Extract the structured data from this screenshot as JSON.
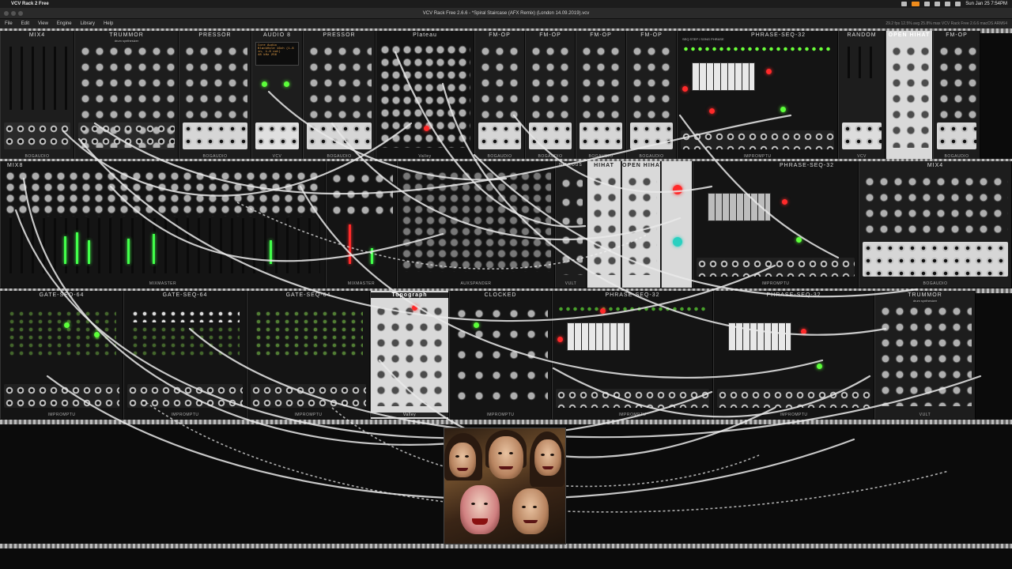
{
  "menubar": {
    "app_name": "VCV Rack 2 Free",
    "clock": "Sun Jan 25  7:54PM"
  },
  "window": {
    "title": "VCV Rack Free 2.6.6 - *Spiral Staircase (AFX Remix) (London 14.09.2019).vcv"
  },
  "app_menu": {
    "items": [
      "File",
      "Edit",
      "View",
      "Engine",
      "Library",
      "Help"
    ],
    "stats": "29.2 fps  12.5% avg  25.8% max    VCV Rack Free 2.6.6 macOS ARM64"
  },
  "row1": {
    "modules": [
      {
        "title": "MIX4",
        "footer": "BOGAUDIO"
      },
      {
        "title": "TRUMMOR",
        "subtitle": "drum synthesizer",
        "footer": ""
      },
      {
        "title": "PRESSOR",
        "footer": "BOGAUDIO"
      },
      {
        "title": "AUDIO 8",
        "footer": "VCV",
        "screen_lines": [
          "Core Audio",
          "BlackHole 16ch (1-8 in, 1-8 out)",
          "48 kHz    256"
        ]
      },
      {
        "title": "PRESSOR",
        "footer": "BOGAUDIO"
      },
      {
        "title": "Plateau",
        "footer": "Valley"
      },
      {
        "title": "FM-OP",
        "footer": "BOGAUDIO"
      },
      {
        "title": "FM-OP",
        "footer": "BOGAUDIO"
      },
      {
        "title": "FM-OP",
        "footer": "BOGAUDIO"
      },
      {
        "title": "FM-OP",
        "footer": "BOGAUDIO"
      },
      {
        "title": "PHRASE-SEQ-32",
        "subtitle": "SEQ STEP / SONG PHRASE",
        "footer": "IMPROMPTU"
      },
      {
        "title": "RANDOM",
        "footer": "VCV"
      },
      {
        "title": "OPEN HIHAT",
        "footer": ""
      },
      {
        "title": "FM-OP",
        "footer": "BOGAUDIO"
      }
    ]
  },
  "row2": {
    "modules": [
      {
        "title": "MIX8",
        "footer": "MIXMASTER"
      },
      {
        "title": "",
        "footer": "MIXMASTER"
      },
      {
        "title": "",
        "footer": "AUXSPANDER"
      },
      {
        "title": "NITROUS",
        "footer": "VULT"
      },
      {
        "title": "HIHAT",
        "footer": ""
      },
      {
        "title": "OPEN HIHAT",
        "footer": ""
      },
      {
        "title": "PHRASE-SEQ-32",
        "footer": "IMPROMPTU"
      },
      {
        "title": "MIX4",
        "footer": "BOGAUDIO"
      }
    ]
  },
  "row3": {
    "modules": [
      {
        "title": "GATE-SEQ-64",
        "footer": "IMPROMPTU"
      },
      {
        "title": "GATE-SEQ-64",
        "footer": "IMPROMPTU"
      },
      {
        "title": "GATE-SEQ-64",
        "footer": "IMPROMPTU"
      },
      {
        "title": "Topograph",
        "footer": "Valley"
      },
      {
        "title": "CLOCKED",
        "footer": "IMPROMPTU"
      },
      {
        "title": "PHRASE-SEQ-32",
        "footer": "IMPROMPTU"
      },
      {
        "title": "PHRASE-SEQ-32",
        "footer": "IMPROMPTU"
      },
      {
        "title": "TRUMMOR",
        "subtitle": "drum synthesizer",
        "footer": "VULT"
      }
    ]
  },
  "colors": {
    "led_green": "#5cff3a",
    "led_red": "#ff2a2a",
    "cable": "#e9e9e9",
    "panel_dark": "#1d1d1d",
    "panel_light": "#d9d9d9"
  }
}
